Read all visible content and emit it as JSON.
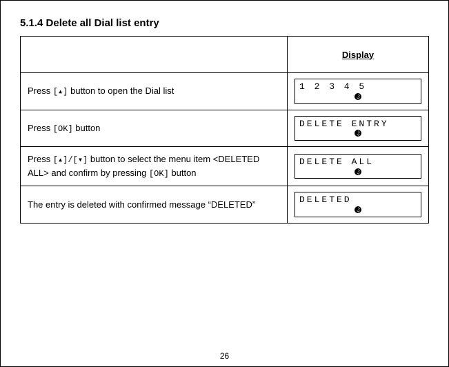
{
  "heading": "5.1.4  Delete all Dial list entry",
  "header": {
    "display": "Display"
  },
  "keys": {
    "up": "[▴]",
    "ok": "[OK]",
    "updown": "[▴]/[▾]"
  },
  "rows": [
    {
      "text_before": "Press ",
      "key": "up",
      "text_after": "  button to open the Dial list",
      "lcd": "1 2 3 4 5"
    },
    {
      "text_before": "Press ",
      "key": "ok",
      "text_after": " button",
      "lcd": "DELETE  ENTRY"
    },
    {
      "text_before": "Press ",
      "key": "updown",
      "text_mid": " button to select the menu item <DELETED ALL> and confirm by pressing ",
      "key2": "ok",
      "text_after": " button",
      "lcd": "DELETE  ALL"
    },
    {
      "text_plain": "The entry is deleted  with confirmed message “DELETED”",
      "lcd": "DELETED"
    }
  ],
  "pagenum": "26"
}
